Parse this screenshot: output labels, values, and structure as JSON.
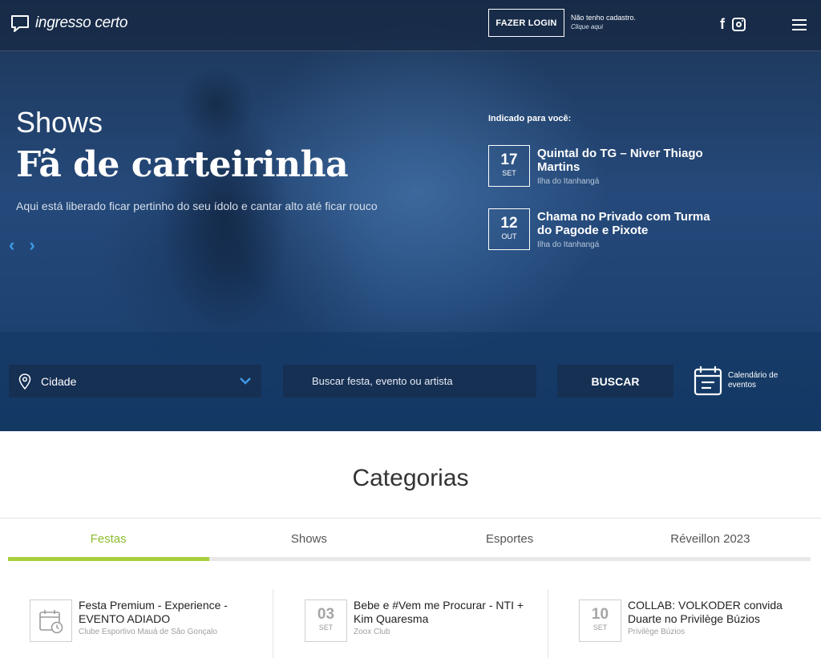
{
  "header": {
    "logo_text": "ingresso certo",
    "login_label": "FAZER LOGIN",
    "signup_line1": "Não tenho cadastro.",
    "signup_line2": "Clique aqui",
    "social": [
      "facebook-icon",
      "instagram-icon"
    ],
    "menu_icon": "hamburger-menu-icon"
  },
  "hero": {
    "category": "Shows",
    "title": "Fã de carteirinha",
    "subtitle": "Aqui está liberado ficar pertinho do seu ídolo e cantar alto até ficar rouco",
    "prev_icon": "chevron-left-icon",
    "next_icon": "chevron-right-icon"
  },
  "recommended": {
    "title": "Indicado para você:",
    "items": [
      {
        "day": "17",
        "month": "SET",
        "name": "Quintal do TG – Niver Thiago Martins",
        "venue": "Ilha do Itanhangá"
      },
      {
        "day": "12",
        "month": "OUT",
        "name": "Chama no Privado com Turma do Pagode e Pixote",
        "venue": "Ilha do Itanhangá"
      }
    ]
  },
  "search": {
    "city_label": "Cidade",
    "query_placeholder": "Buscar festa, evento ou artista",
    "button_label": "BUSCAR",
    "calendar_label": "Calendário de eventos"
  },
  "categories": {
    "heading": "Categorias",
    "tabs": [
      {
        "label": "Festas",
        "active": true
      },
      {
        "label": "Shows",
        "active": false
      },
      {
        "label": "Esportes",
        "active": false
      },
      {
        "label": "Réveillon 2023",
        "active": false
      }
    ],
    "events": [
      {
        "day": "",
        "month": "",
        "icon": "calendar-clock-icon",
        "name": "Festa Premium - Experience - EVENTO ADIADO",
        "venue": "Clube Esportivo Mauá de São Gonçalo"
      },
      {
        "day": "03",
        "month": "SET",
        "name": "Bebe e #Vem me Procurar - NTI + Kim Quaresma",
        "venue": "Zoox Club"
      },
      {
        "day": "10",
        "month": "SET",
        "name": "COLLAB: VOLKODER convida Duarte no Privilège Búzios",
        "venue": "Privilège Búzios"
      }
    ]
  },
  "colors": {
    "accent_green": "#a8cf3a",
    "arrow_blue": "#3f9ae8",
    "field_bg": "#163054"
  }
}
